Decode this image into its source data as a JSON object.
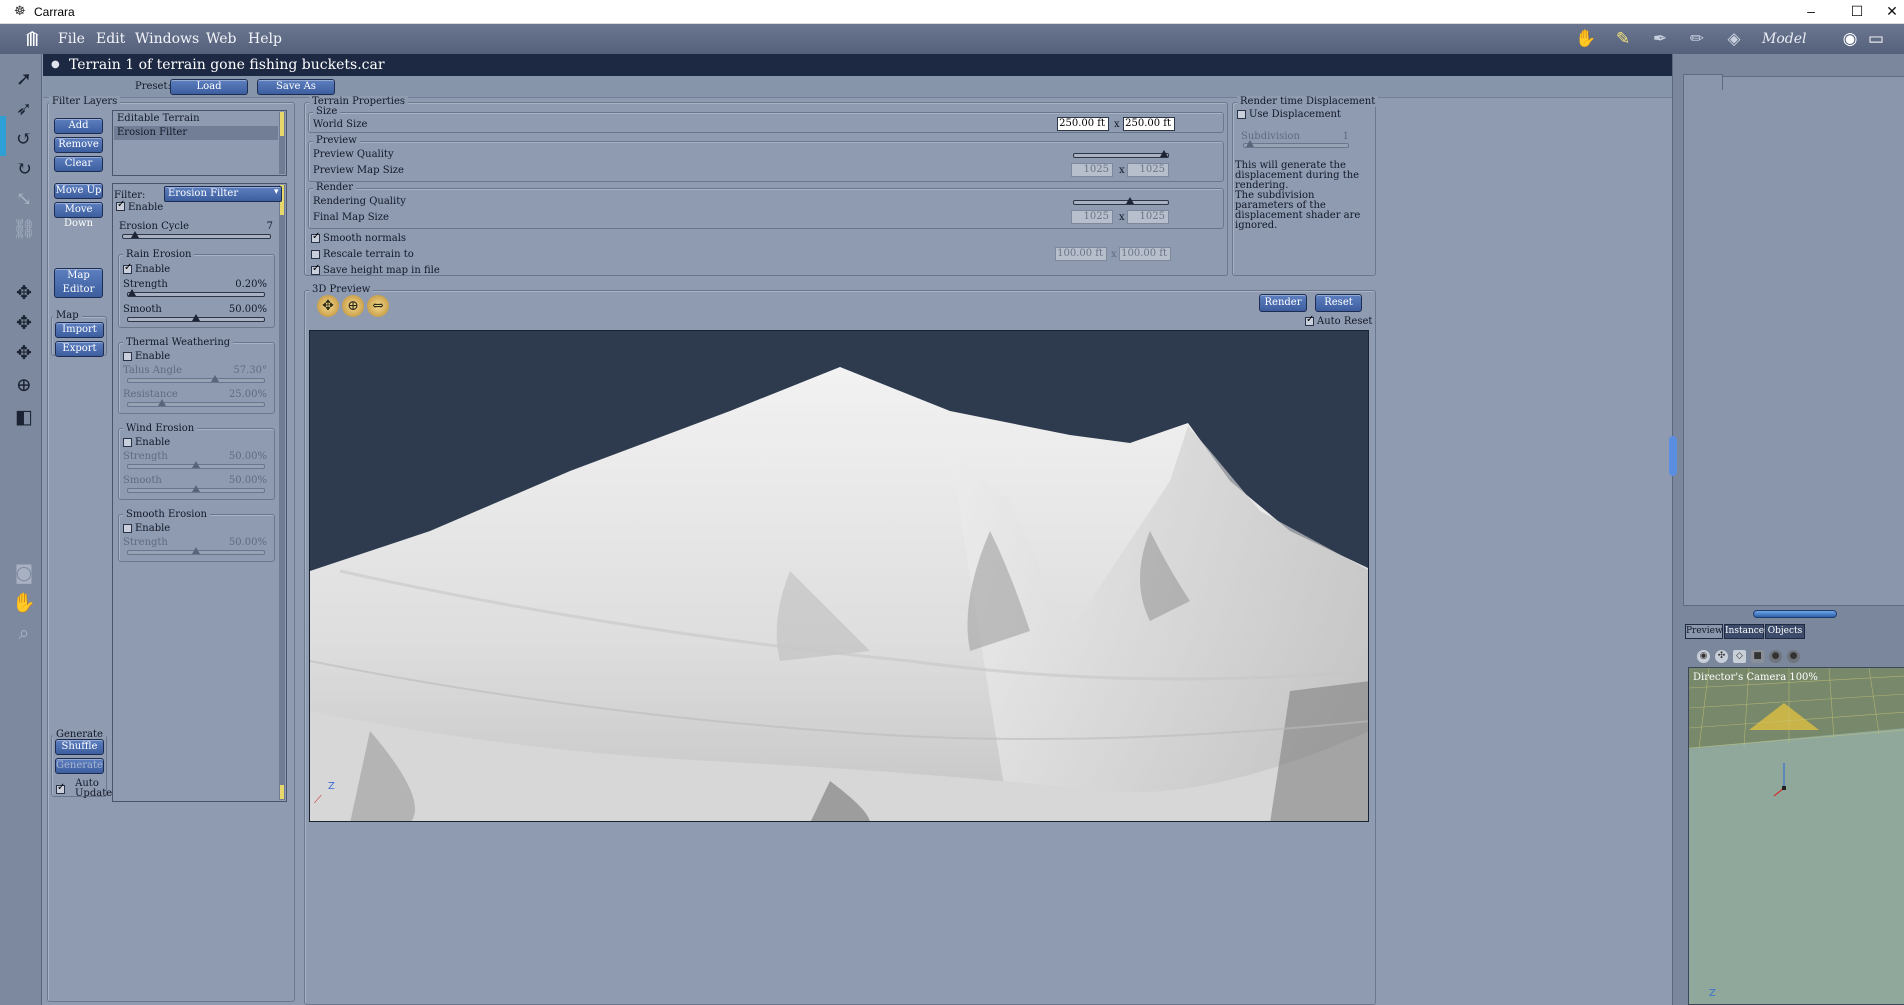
{
  "window": {
    "app_title": "Carrara",
    "min": "–",
    "max": "☐",
    "close": "✕"
  },
  "menubar": {
    "items": [
      "File",
      "Edit",
      "Windows",
      "Web",
      "Help"
    ],
    "room_label": "Model",
    "rooms": [
      "assemble-room-icon",
      "model-room-icon",
      "storyboard-room-icon",
      "texture-room-icon",
      "render-room-icon"
    ]
  },
  "document": {
    "title": "Terrain 1 of terrain gone fishing buckets.car",
    "preset_label": "Preset:",
    "load": "Load",
    "save_as": "Save As"
  },
  "filter_layers": {
    "legend": "Filter Layers",
    "buttons": {
      "add": "Add",
      "remove": "Remove",
      "clear": "Clear",
      "move_up": "Move Up",
      "move_down": "Move Down",
      "map_editor": "Map Editor"
    },
    "layers": [
      "Editable Terrain",
      "Erosion Filter"
    ],
    "selected_index": 1,
    "map": {
      "legend": "Map",
      "import": "Import",
      "export": "Export"
    },
    "generate": {
      "legend": "Generate",
      "shuffle": "Shuffle",
      "generate": "Generate",
      "auto_update": "Auto Update",
      "auto_update_checked": true
    }
  },
  "filter": {
    "label": "Filter:",
    "value": "Erosion Filter",
    "enable": "Enable",
    "enabled": true,
    "erosion_cycle": {
      "label": "Erosion Cycle",
      "value": "7",
      "fraction": 0.08
    },
    "rain": {
      "legend": "Rain Erosion",
      "enable": "Enable",
      "enabled": true,
      "strength": {
        "label": "Strength",
        "value": "0.20%",
        "fraction": 0.02
      },
      "smooth": {
        "label": "Smooth",
        "value": "50.00%",
        "fraction": 0.5
      }
    },
    "thermal": {
      "legend": "Thermal Weathering",
      "enable": "Enable",
      "enabled": false,
      "talus": {
        "label": "Talus Angle",
        "value": "57.30°",
        "fraction": 0.64
      },
      "resistance": {
        "label": "Resistance",
        "value": "25.00%",
        "fraction": 0.25
      }
    },
    "wind": {
      "legend": "Wind Erosion",
      "enable": "Enable",
      "enabled": false,
      "strength": {
        "label": "Strength",
        "value": "50.00%",
        "fraction": 0.5
      },
      "smooth": {
        "label": "Smooth",
        "value": "50.00%",
        "fraction": 0.5
      }
    },
    "smooth_erosion": {
      "legend": "Smooth Erosion",
      "enable": "Enable",
      "enabled": false,
      "strength": {
        "label": "Strength",
        "value": "50.00%",
        "fraction": 0.5
      }
    }
  },
  "terrain_properties": {
    "legend": "Terrain Properties",
    "size": {
      "legend": "Size",
      "world_size": "World Size",
      "w": "250.00 ft",
      "h": "250.00 ft",
      "x": "x"
    },
    "preview": {
      "legend": "Preview",
      "quality": "Preview Quality",
      "quality_fraction": 0.97,
      "map_size": "Preview Map Size",
      "w": "1025",
      "h": "1025",
      "x": "x"
    },
    "render": {
      "legend": "Render",
      "quality": "Rendering Quality",
      "quality_fraction": 0.6,
      "map_size": "Final Map Size",
      "w": "1025",
      "h": "1025",
      "x": "x"
    },
    "smooth_normals": "Smooth normals",
    "smooth_normals_checked": true,
    "rescale": "Rescale terrain to",
    "rescale_checked": false,
    "rescale_w": "100.00 ft",
    "rescale_h": "100.00 ft",
    "rescale_x": "x",
    "save_height": "Save height map in file",
    "save_height_checked": true
  },
  "render_displacement": {
    "legend": "Render time Displacement",
    "use": "Use Displacement",
    "use_checked": false,
    "subdivision": "Subdivision",
    "subdivision_value": "1",
    "note1": "This will generate the displacement during the rendering.",
    "note2": "The subdivision parameters of the displacement shader are ignored."
  },
  "preview3d": {
    "legend": "3D Preview",
    "render": "Render",
    "reset": "Reset",
    "auto_reset": "Auto Reset",
    "auto_reset_checked": true,
    "axis_z": "Z"
  },
  "right_panel": {
    "tabs": [
      "Preview",
      "Instances",
      "Objects"
    ],
    "camera_label": "Director's Camera 100%",
    "axis_z": "Z"
  }
}
